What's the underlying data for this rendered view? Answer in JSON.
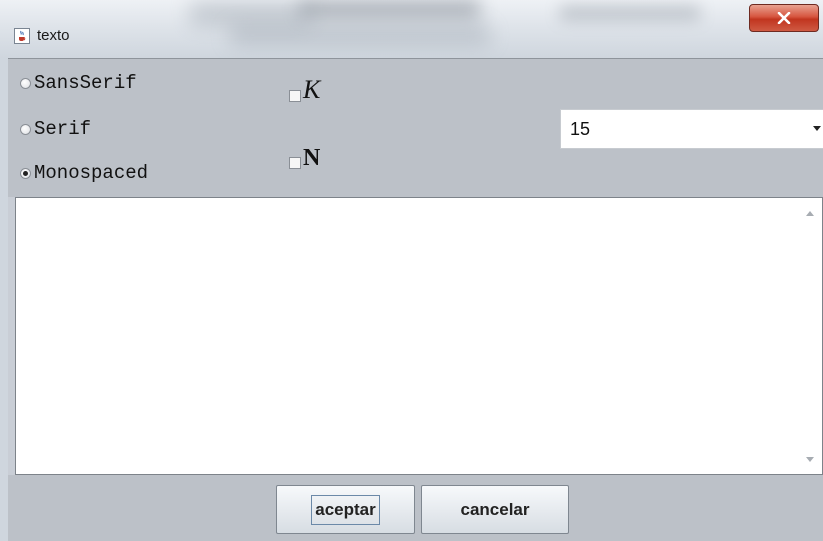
{
  "window": {
    "title": "texto",
    "close_label": "X"
  },
  "font_family": {
    "options": [
      {
        "label": "SansSerif",
        "selected": false
      },
      {
        "label": "Serif",
        "selected": false
      },
      {
        "label": "Monospaced",
        "selected": true
      }
    ]
  },
  "style": {
    "italic_label": "K",
    "italic_checked": false,
    "bold_label": "N",
    "bold_checked": false
  },
  "size": {
    "value": "15"
  },
  "text_area": {
    "value": ""
  },
  "buttons": {
    "ok_label": "aceptar",
    "cancel_label": "cancelar"
  },
  "colors": {
    "panel": "#bcc1c8",
    "close_button": "#c1351f"
  },
  "icons": [
    "java-cup-icon",
    "close-x-icon",
    "dropdown-arrow-icon",
    "scroll-up-arrow-icon",
    "scroll-down-arrow-icon"
  ]
}
